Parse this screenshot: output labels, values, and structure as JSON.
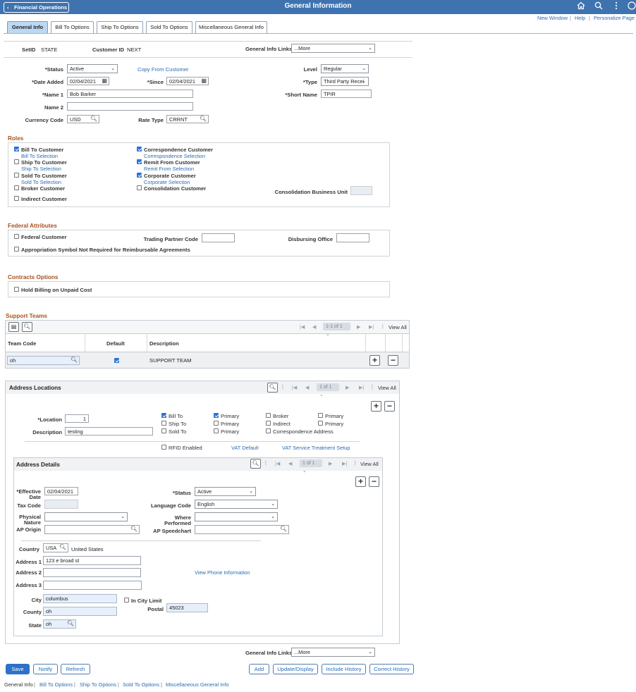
{
  "header": {
    "back_label": "Financial Operations",
    "title": "General Information",
    "links": [
      "New Window",
      "Help",
      "Personalize Page"
    ]
  },
  "tabs": [
    "General Info",
    "Bill To Options",
    "Ship To Options",
    "Sold To Options",
    "Miscellaneous General Info"
  ],
  "info": {
    "setid_label": "SetID",
    "setid_value": "STATE",
    "customer_id_label": "Customer ID",
    "customer_id_value": "NEXT",
    "gen_info_links_label": "General Info Links",
    "gen_info_links_value": "...More"
  },
  "form": {
    "status_label": "*Status",
    "status_value": "Active",
    "copy_from": "Copy From Customer",
    "level_label": "Level",
    "level_value": "Regular",
    "date_added_label": "*Date Added",
    "date_added_value": "02/04/2021",
    "since_label": "*Since",
    "since_value": "02/04/2021",
    "type_label": "*Type",
    "type_value": "Third Party Recei",
    "name1_label": "*Name 1",
    "name1_value": "Bob Barker",
    "short_name_label": "*Short Name",
    "short_name_value": "TPIR",
    "name2_label": "Name 2",
    "name2_value": "",
    "currency_label": "Currency Code",
    "currency_value": "USD",
    "rate_type_label": "Rate Type",
    "rate_type_value": "CRRNT"
  },
  "roles": {
    "title": "Roles",
    "bill_to": "Bill To Customer",
    "bill_to_sel": "Bill To Selection",
    "ship_to": "Ship To Customer",
    "ship_to_sel": "Ship To Selection",
    "sold_to": "Sold To Customer",
    "sold_to_sel": "Sold To Selection",
    "broker": "Broker Customer",
    "indirect": "Indirect Customer",
    "corr": "Correspondence Customer",
    "corr_sel": "Correspondence Selection",
    "remit": "Remit From Customer",
    "remit_sel": "Remit From Selection",
    "corporate": "Corporate Customer",
    "corporate_sel": "Corporate Selection",
    "consol": "Consolidation Customer",
    "consol_bu_label": "Consolidation Business Unit"
  },
  "federal": {
    "title": "Federal Attributes",
    "federal_customer": "Federal Customer",
    "trading_partner_label": "Trading Partner Code",
    "disbursing_label": "Disbursing Office",
    "approp": "Appropriation Symbol Not Required for Reimbursable Agreements"
  },
  "contracts": {
    "title": "Contracts Options",
    "hold_billing": "Hold Billing on Unpaid Cost"
  },
  "support": {
    "title": "Support Teams",
    "nav": "1-1 of 1",
    "view_all": "View All",
    "col_team": "Team Code",
    "col_default": "Default",
    "col_desc": "Description",
    "team_value": "oh",
    "desc_value": "SUPPORT TEAM"
  },
  "address": {
    "title": "Address Locations",
    "nav": "1 of 1",
    "view_all": "View All",
    "location_label": "*Location",
    "location_value": "1",
    "description_label": "Description",
    "description_value": "testing",
    "bill_to": "Bill To",
    "ship_to": "Ship To",
    "sold_to": "Sold To",
    "primary": "Primary",
    "broker": "Broker",
    "indirect": "Indirect",
    "corr_address": "Correspondence Address",
    "rfid": "RFID Enabled",
    "vat_default": "VAT Default",
    "vat_service": "VAT Service Treatment Setup"
  },
  "details": {
    "title": "Address Details",
    "nav": "1 of 1",
    "view_all": "View All",
    "eff_date_label": "*Effective Date",
    "eff_date_value": "02/04/2021",
    "status_label": "*Status",
    "status_value": "Active",
    "tax_code_label": "Tax Code",
    "language_label": "Language Code",
    "language_value": "English",
    "physical_label": "Physical Nature",
    "where_label": "Where Performed",
    "ap_origin_label": "AP Origin",
    "ap_speedchart_label": "AP Speedchart",
    "country_label": "Country",
    "country_value": "USA",
    "country_name": "United States",
    "addr1_label": "Address 1",
    "addr1_value": "123 e broad st",
    "addr2_label": "Address 2",
    "addr3_label": "Address 3",
    "view_phone": "View Phone Information",
    "city_label": "City",
    "city_value": "columbus",
    "in_city": "In City Limit",
    "county_label": "County",
    "county_value": "oh",
    "postal_label": "Postal",
    "postal_value": "45023",
    "state_label": "State",
    "state_value": "oh"
  },
  "bottom": {
    "gen_info_links_label": "General Info Links",
    "gen_info_links_value": "...More"
  },
  "buttons": {
    "save": "Save",
    "notify": "Notify",
    "refresh": "Refresh",
    "add": "Add",
    "update": "Update/Display",
    "include_history": "Include History",
    "correct_history": "Correct History"
  },
  "footer": [
    "General Info",
    "Bill To Options",
    "Ship To Options",
    "Sold To Options",
    "Miscellaneous General Info"
  ]
}
